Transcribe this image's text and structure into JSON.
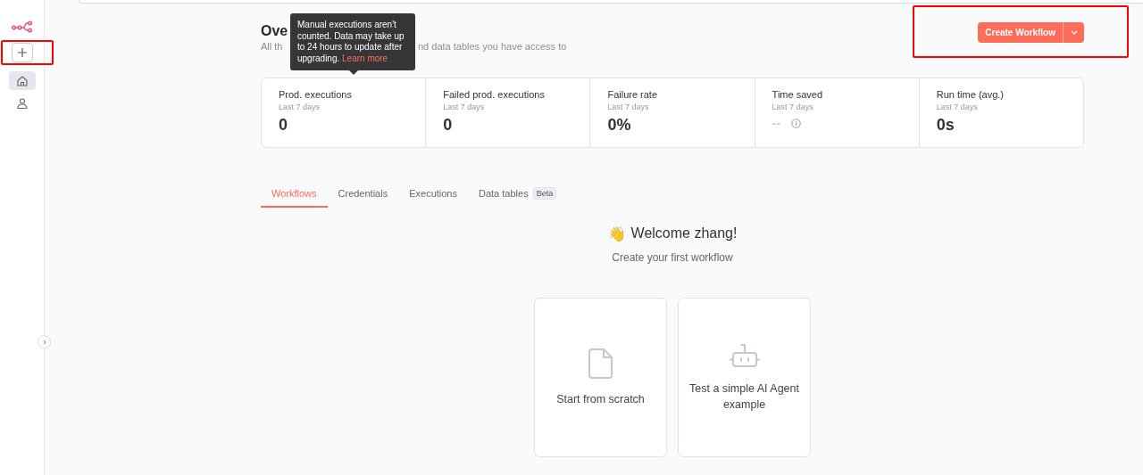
{
  "sidebar": {
    "items": [
      {
        "selected": true
      },
      {
        "selected": false
      }
    ]
  },
  "header": {
    "title": "Ove",
    "subtitle_parts": [
      "All th",
      "nd data tables you have access to"
    ]
  },
  "tooltip": {
    "text": "Manual executions aren't counted. Data may take up to 24 hours to update after upgrading.",
    "link": "Learn more"
  },
  "create_button": {
    "label": "Create Workflow"
  },
  "stats": [
    {
      "label": "Prod. executions",
      "period": "Last 7 days",
      "value": "0",
      "muted": false
    },
    {
      "label": "Failed prod. executions",
      "period": "Last 7 days",
      "value": "0",
      "muted": false
    },
    {
      "label": "Failure rate",
      "period": "Last 7 days",
      "value": "0%",
      "muted": false
    },
    {
      "label": "Time saved",
      "period": "Last 7 days",
      "value": "--",
      "muted": true
    },
    {
      "label": "Run time (avg.)",
      "period": "Last 7 days",
      "value": "0s",
      "muted": false
    }
  ],
  "tabs": [
    {
      "label": "Workflows",
      "selected": true
    },
    {
      "label": "Credentials",
      "selected": false
    },
    {
      "label": "Executions",
      "selected": false
    },
    {
      "label": "Data tables",
      "selected": false,
      "badge": "Beta"
    }
  ],
  "welcome": {
    "emoji": "👋",
    "title": "Welcome zhang!",
    "subtitle": "Create your first workflow"
  },
  "cards": [
    {
      "label": "Start from scratch"
    },
    {
      "label": "Test a simple AI Agent example"
    }
  ]
}
